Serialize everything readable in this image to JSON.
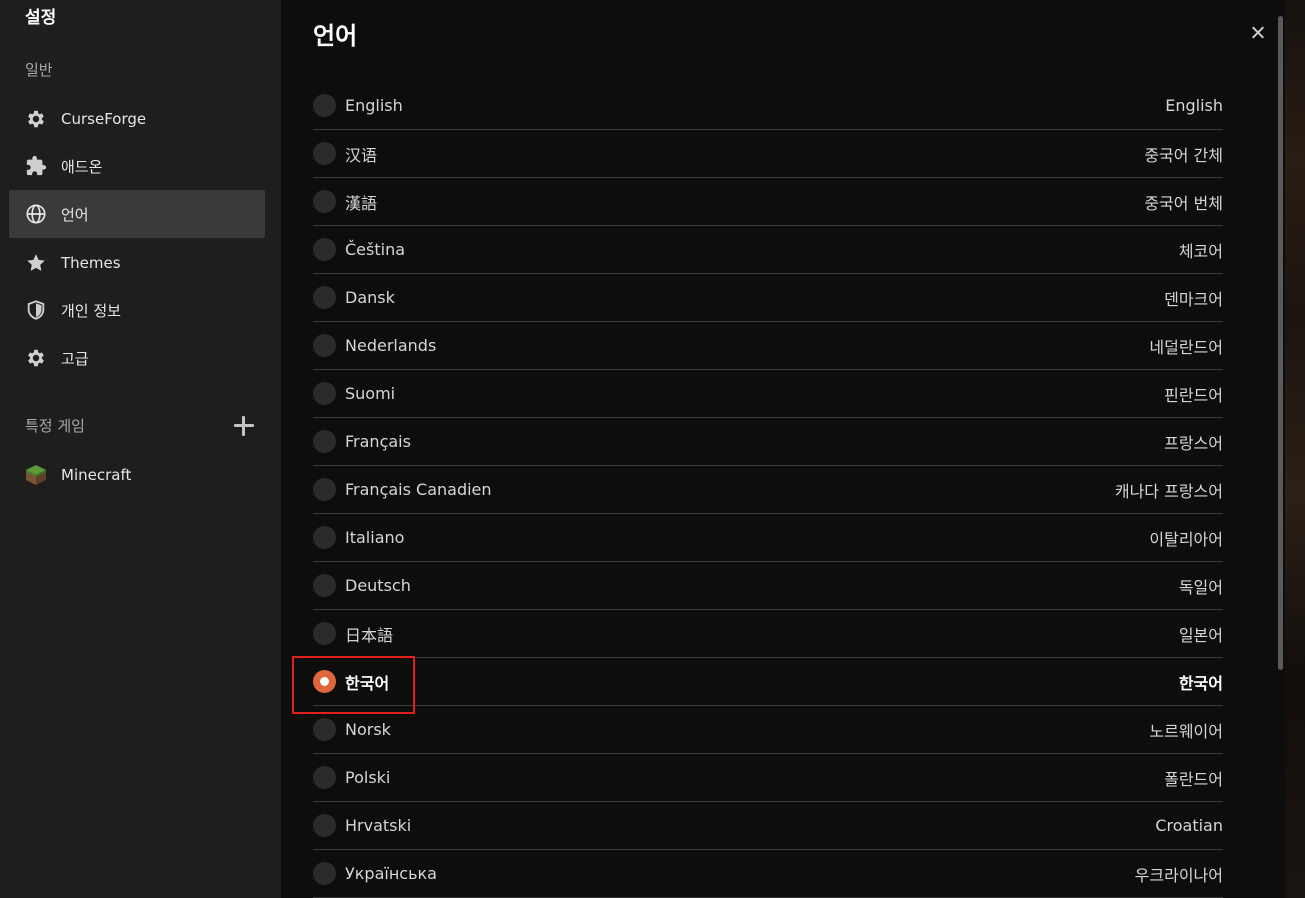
{
  "sidebar": {
    "title": "설정",
    "general_label": "일반",
    "games_label": "특정 게임",
    "items": [
      {
        "label": "CurseForge",
        "icon": "gear-icon"
      },
      {
        "label": "애드온",
        "icon": "puzzle-icon"
      },
      {
        "label": "언어",
        "icon": "globe-icon",
        "active": true
      },
      {
        "label": "Themes",
        "icon": "star-icon"
      },
      {
        "label": "개인 정보",
        "icon": "shield-icon"
      },
      {
        "label": "고급",
        "icon": "gear-icon"
      }
    ],
    "games": [
      {
        "label": "Minecraft",
        "icon": "minecraft-grass-block-icon"
      }
    ]
  },
  "main": {
    "title": "언어",
    "languages": [
      {
        "native": "English",
        "local": "English"
      },
      {
        "native": "汉语",
        "local": "중국어 간체"
      },
      {
        "native": "漢語",
        "local": "중국어 번체"
      },
      {
        "native": "Čeština",
        "local": "체코어"
      },
      {
        "native": "Dansk",
        "local": "덴마크어"
      },
      {
        "native": "Nederlands",
        "local": "네덜란드어"
      },
      {
        "native": "Suomi",
        "local": "핀란드어"
      },
      {
        "native": "Français",
        "local": "프랑스어"
      },
      {
        "native": "Français Canadien",
        "local": "캐나다 프랑스어"
      },
      {
        "native": "Italiano",
        "local": "이탈리아어"
      },
      {
        "native": "Deutsch",
        "local": "독일어"
      },
      {
        "native": "日本語",
        "local": "일본어"
      },
      {
        "native": "한국어",
        "local": "한국어",
        "selected": true
      },
      {
        "native": "Norsk",
        "local": "노르웨이어"
      },
      {
        "native": "Polski",
        "local": "폴란드어"
      },
      {
        "native": "Hrvatski",
        "local": "Croatian"
      },
      {
        "native": "Українська",
        "local": "우크라이나어"
      }
    ]
  },
  "colors": {
    "accent": "#e0673c",
    "highlight": "#e01e1e",
    "sidebar_bg": "#1e1e1e",
    "main_bg": "#0d0d0d"
  }
}
